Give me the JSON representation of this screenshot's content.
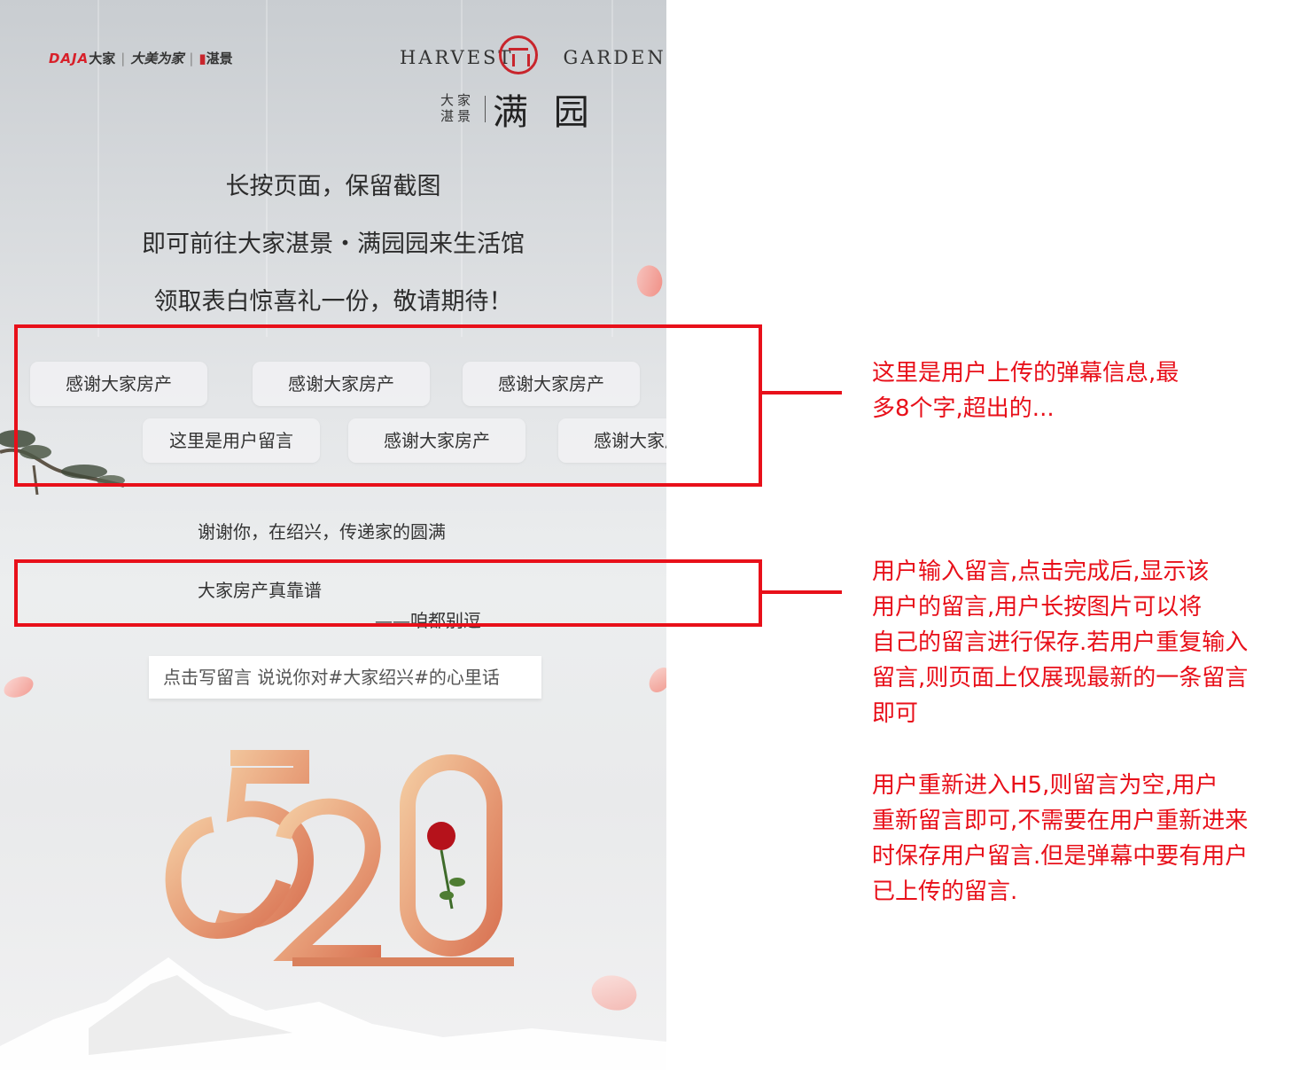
{
  "brand": {
    "daja_text": "DAJA",
    "daja_cn": "大家",
    "slogan": "大美为家",
    "zhanjing": "湛景",
    "harvest": "HARVEST",
    "garden": "GARDEN",
    "small_line1": "大家",
    "small_line2": "湛景",
    "project_name": "满 园"
  },
  "intro": {
    "line1": "长按页面，保留截图",
    "line2": "即可前往大家湛景・满园园来生活馆",
    "line3": "领取表白惊喜礼一份，敬请期待！"
  },
  "danmaku": [
    "感谢大家房产",
    "感谢大家房产",
    "感谢大家房产",
    "这里是用户留言",
    "感谢大家房产",
    "感谢大家房产"
  ],
  "thanks_text": "谢谢你，在绍兴，传递家的圆满",
  "user_message": "大家房产真靠谱",
  "signature": "——咱都别逗",
  "message_input": {
    "placeholder": "点击写留言  说说你对#大家绍兴#的心里话"
  },
  "artwork": {
    "number": "520"
  },
  "annotations": {
    "note1": [
      "这里是用户上传的弹幕信息,最",
      "多8个字,超出的..."
    ],
    "note2": [
      "用户输入留言,点击完成后,显示该",
      "用户的留言,用户长按图片可以将",
      "自己的留言进行保存.若用户重复输入",
      "留言,则页面上仅展现最新的一条留言",
      "即可"
    ],
    "note3": [
      "用户重新进入H5,则留言为空,用户",
      "重新留言即可,不需要在用户重新进来",
      "时保存用户留言.但是弹幕中要有用户",
      "已上传的留言."
    ]
  },
  "colors": {
    "annotation_red": "#e8101a",
    "brand_red": "#c8252c",
    "gold": "#e6a275"
  }
}
